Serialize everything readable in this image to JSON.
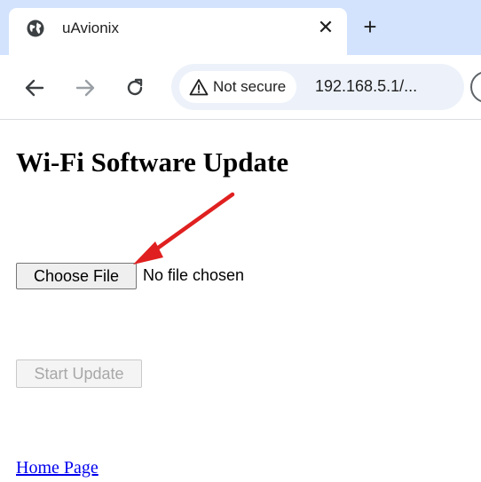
{
  "browser": {
    "tab": {
      "title": "uAvionix",
      "close_glyph": "✕",
      "favicon": "globe-icon"
    },
    "new_tab_glyph": "+",
    "toolbar": {
      "back": "arrow-left-icon",
      "forward": "arrow-right-icon",
      "reload": "reload-icon"
    },
    "address_bar": {
      "security_label": "Not secure",
      "url": "192.168.5.1/...",
      "warning_icon": "warning-icon"
    }
  },
  "page": {
    "title": "Wi-Fi Software Update",
    "file_input": {
      "button_label": "Choose File",
      "status": "No file chosen"
    },
    "start_button": {
      "label": "Start Update",
      "disabled": true
    },
    "home_link": "Home Page"
  },
  "annotation": {
    "arrow_color": "#e02020"
  },
  "colors": {
    "tabstrip": "#d3e3fd",
    "omnibox": "#edf2fa",
    "link": "#0000ee"
  }
}
